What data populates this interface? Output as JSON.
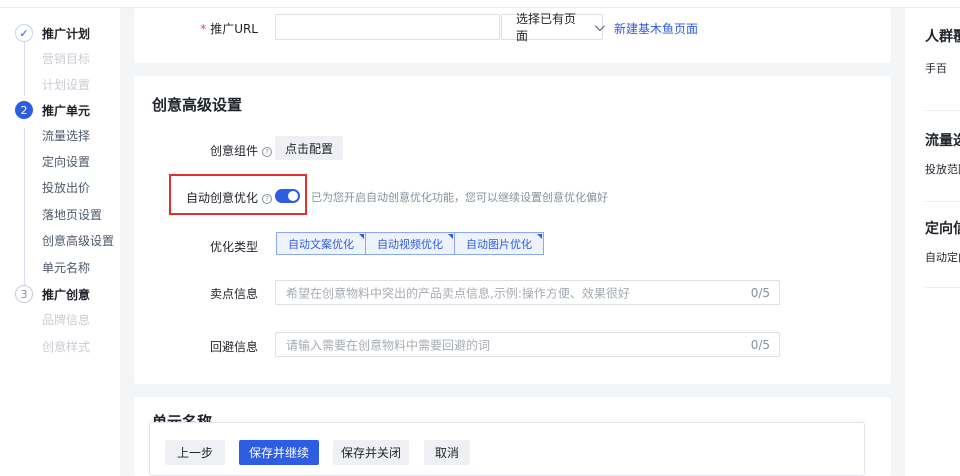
{
  "sidebar": {
    "steps": [
      {
        "index": "✓",
        "title": "推广计划",
        "status": "done",
        "subs": [
          {
            "label": "营销目标",
            "muted": true
          },
          {
            "label": "计划设置",
            "muted": true
          }
        ]
      },
      {
        "index": "2",
        "title": "推广单元",
        "status": "active",
        "subs": [
          {
            "label": "流量选择",
            "muted": false
          },
          {
            "label": "定向设置",
            "muted": false
          },
          {
            "label": "投放出价",
            "muted": false
          },
          {
            "label": "落地页设置",
            "muted": false
          },
          {
            "label": "创意高级设置",
            "muted": false
          },
          {
            "label": "单元名称",
            "muted": false
          }
        ]
      },
      {
        "index": "3",
        "title": "推广创意",
        "status": "todo",
        "subs": [
          {
            "label": "品牌信息",
            "muted": true
          },
          {
            "label": "创意样式",
            "muted": true
          }
        ]
      }
    ]
  },
  "url_section": {
    "label": "推广URL",
    "required_mark": "*",
    "input_value": "",
    "select_label": "选择已有页面",
    "new_page_link": "新建基木鱼页面"
  },
  "creative": {
    "title": "创意高级设置",
    "component_label": "创意组件",
    "component_button": "点击配置",
    "auto_label": "自动创意优化",
    "auto_enabled": true,
    "auto_hint": "已为您开启自动创意优化功能，您可以继续设置创意优化偏好",
    "opt_type_label": "优化类型",
    "opt_types": [
      "自动文案优化",
      "自动视频优化",
      "自动图片优化"
    ],
    "selling_label": "卖点信息",
    "selling_placeholder": "希望在创意物料中突出的产品卖点信息,示例:操作方便、效果很好",
    "selling_count": "0/5",
    "avoid_label": "回避信息",
    "avoid_placeholder": "请输入需要在创意物料中需要回避的词",
    "avoid_count": "0/5"
  },
  "unit_name": {
    "title": "单元名称"
  },
  "footer": {
    "prev": "上一步",
    "save_continue": "保存并继续",
    "save_close": "保存并关闭",
    "cancel": "取消"
  },
  "summary": {
    "sections": [
      {
        "title": "人群覆",
        "value": "手百"
      },
      {
        "title": "流量选",
        "value": "投放范围"
      },
      {
        "title": "定向信",
        "value": "自动定向"
      }
    ]
  },
  "colors": {
    "primary": "#2d5de0",
    "highlight": "#e0312f",
    "required": "#f53f3f"
  }
}
